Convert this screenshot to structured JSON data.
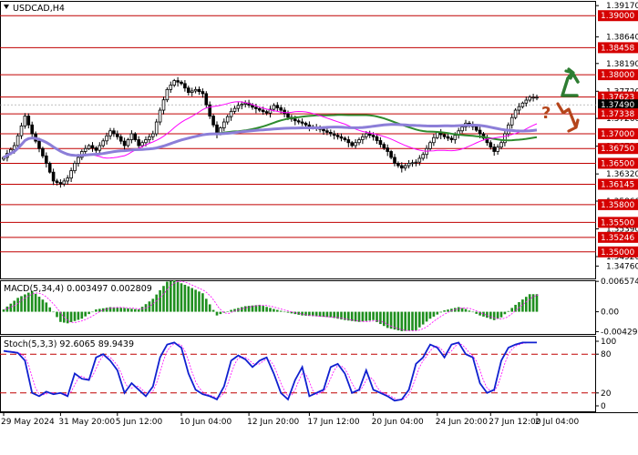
{
  "chart_data": [
    {
      "type": "candlestick",
      "title": "USDCAD,H4",
      "ylim": [
        1.3455,
        1.3925
      ],
      "y_ticks": [
        "1.39170",
        "1.38640",
        "1.38190",
        "1.37720",
        "1.37260",
        "1.36790",
        "1.36320",
        "1.35860",
        "1.35390",
        "1.34920",
        "1.34760"
      ],
      "levels": [
        {
          "value": 1.39,
          "label": "1.39000",
          "kind": "level"
        },
        {
          "value": 1.38458,
          "label": "1.38458",
          "kind": "level"
        },
        {
          "value": 1.38,
          "label": "1.38000",
          "kind": "level"
        },
        {
          "value": 1.37623,
          "label": "1.37623",
          "kind": "level"
        },
        {
          "value": 1.3749,
          "label": "1.37490",
          "kind": "price"
        },
        {
          "value": 1.37338,
          "label": "1.37338",
          "kind": "level"
        },
        {
          "value": 1.37,
          "label": "1.37000",
          "kind": "level"
        },
        {
          "value": 1.3675,
          "label": "1.36750",
          "kind": "level"
        },
        {
          "value": 1.365,
          "label": "1.36500",
          "kind": "level"
        },
        {
          "value": 1.36145,
          "label": "1.36145",
          "kind": "level"
        },
        {
          "value": 1.358,
          "label": "1.35800",
          "kind": "level"
        },
        {
          "value": 1.355,
          "label": "1.35500",
          "kind": "level"
        },
        {
          "value": 1.35246,
          "label": "1.35246",
          "kind": "level"
        },
        {
          "value": 1.35,
          "label": "1.35000",
          "kind": "level"
        }
      ],
      "anchors": [
        [
          0,
          1.366
        ],
        [
          3,
          1.368
        ],
        [
          6,
          1.373
        ],
        [
          8,
          1.37
        ],
        [
          10,
          1.3675
        ],
        [
          12,
          1.365
        ],
        [
          14,
          1.362
        ],
        [
          16,
          1.3615
        ],
        [
          18,
          1.3625
        ],
        [
          20,
          1.365
        ],
        [
          22,
          1.367
        ],
        [
          24,
          1.368
        ],
        [
          26,
          1.3672
        ],
        [
          28,
          1.3688
        ],
        [
          30,
          1.3705
        ],
        [
          32,
          1.3695
        ],
        [
          34,
          1.368
        ],
        [
          36,
          1.37
        ],
        [
          38,
          1.368
        ],
        [
          40,
          1.369
        ],
        [
          42,
          1.37
        ],
        [
          44,
          1.374
        ],
        [
          46,
          1.3775
        ],
        [
          48,
          1.379
        ],
        [
          50,
          1.3785
        ],
        [
          52,
          1.377
        ],
        [
          54,
          1.3775
        ],
        [
          56,
          1.3768
        ],
        [
          58,
          1.373
        ],
        [
          60,
          1.37
        ],
        [
          62,
          1.372
        ],
        [
          64,
          1.3738
        ],
        [
          66,
          1.3748
        ],
        [
          68,
          1.3752
        ],
        [
          70,
          1.3745
        ],
        [
          72,
          1.374
        ],
        [
          74,
          1.3735
        ],
        [
          76,
          1.3748
        ],
        [
          78,
          1.374
        ],
        [
          80,
          1.3728
        ],
        [
          82,
          1.3722
        ],
        [
          84,
          1.3718
        ],
        [
          86,
          1.3712
        ],
        [
          88,
          1.371
        ],
        [
          90,
          1.3705
        ],
        [
          92,
          1.37
        ],
        [
          94,
          1.3695
        ],
        [
          96,
          1.369
        ],
        [
          98,
          1.368
        ],
        [
          100,
          1.369
        ],
        [
          102,
          1.37
        ],
        [
          104,
          1.3695
        ],
        [
          106,
          1.3682
        ],
        [
          108,
          1.367
        ],
        [
          110,
          1.365
        ],
        [
          112,
          1.3642
        ],
        [
          114,
          1.365
        ],
        [
          116,
          1.3652
        ],
        [
          118,
          1.3665
        ],
        [
          120,
          1.3685
        ],
        [
          122,
          1.3702
        ],
        [
          124,
          1.3695
        ],
        [
          126,
          1.369
        ],
        [
          128,
          1.3705
        ],
        [
          130,
          1.3718
        ],
        [
          132,
          1.3712
        ],
        [
          134,
          1.37
        ],
        [
          136,
          1.3685
        ],
        [
          138,
          1.367
        ],
        [
          140,
          1.3685
        ],
        [
          142,
          1.3715
        ],
        [
          144,
          1.374
        ],
        [
          146,
          1.3752
        ],
        [
          148,
          1.3762
        ]
      ],
      "moving_averages": [
        {
          "color": "#2e8b2e",
          "period": 60
        },
        {
          "color": "#ff00ff",
          "period": 22
        },
        {
          "color": "#8c7ed8",
          "period": 90
        }
      ],
      "x_ticks": [
        {
          "index": 0,
          "label": "29 May 2024"
        },
        {
          "index": 16,
          "label": "31 May 20:00"
        },
        {
          "index": 32,
          "label": "5 Jun 12:00"
        },
        {
          "index": 50,
          "label": "10 Jun 04:00"
        },
        {
          "index": 69,
          "label": "12 Jun 20:00"
        },
        {
          "index": 86,
          "label": "17 Jun 12:00"
        },
        {
          "index": 104,
          "label": "20 Jun 04:00"
        },
        {
          "index": 122,
          "label": "24 Jun 20:00"
        },
        {
          "index": 137,
          "label": "27 Jun 12:00"
        },
        {
          "index": 150,
          "label": "2 Jul 04:00"
        }
      ],
      "annotations": {
        "question_mark": "?",
        "up_arrow_color": "#2e7d32",
        "down_arrow_color": "#b5451b"
      }
    },
    {
      "type": "bar",
      "title": "MACD(5,34,4) 0.003497 0.002809",
      "ylim": [
        -0.0048,
        0.0068
      ],
      "y_ticks": [
        "0.006574",
        "0.00",
        "-0.004292"
      ],
      "bar_color": "#1f8f1f",
      "signal_color": "#ff00ff",
      "anchors": [
        [
          0,
          0.0005
        ],
        [
          4,
          0.003
        ],
        [
          8,
          0.0045
        ],
        [
          12,
          0.002
        ],
        [
          16,
          -0.0022
        ],
        [
          18,
          -0.0025
        ],
        [
          22,
          -0.0015
        ],
        [
          26,
          0.0005
        ],
        [
          30,
          0.001
        ],
        [
          34,
          0.0008
        ],
        [
          38,
          0.0005
        ],
        [
          42,
          0.0028
        ],
        [
          46,
          0.0065
        ],
        [
          48,
          0.0068
        ],
        [
          52,
          0.0055
        ],
        [
          56,
          0.004
        ],
        [
          60,
          -0.0008
        ],
        [
          64,
          0.0004
        ],
        [
          68,
          0.0012
        ],
        [
          72,
          0.0015
        ],
        [
          76,
          0.0006
        ],
        [
          80,
          -0.0002
        ],
        [
          84,
          -0.0008
        ],
        [
          88,
          -0.001
        ],
        [
          92,
          -0.0012
        ],
        [
          96,
          -0.0018
        ],
        [
          100,
          -0.0022
        ],
        [
          104,
          -0.0018
        ],
        [
          108,
          -0.0035
        ],
        [
          112,
          -0.0042
        ],
        [
          116,
          -0.004
        ],
        [
          120,
          -0.0015
        ],
        [
          124,
          0.0003
        ],
        [
          128,
          0.001
        ],
        [
          130,
          0.0006
        ],
        [
          134,
          -0.0008
        ],
        [
          138,
          -0.0018
        ],
        [
          140,
          -0.0012
        ],
        [
          144,
          0.0015
        ],
        [
          148,
          0.0038
        ]
      ]
    },
    {
      "type": "line",
      "title": "Stoch(5,3,3) 92.6065 89.9439",
      "ylim": [
        0,
        100
      ],
      "y_ticks": [
        "100",
        "80",
        "20",
        "0"
      ],
      "levels": [
        80,
        20
      ],
      "main_color": "#1020d0",
      "signal_color": "#ff00ff",
      "anchors": [
        [
          0,
          85
        ],
        [
          4,
          82
        ],
        [
          6,
          70
        ],
        [
          8,
          20
        ],
        [
          10,
          15
        ],
        [
          12,
          22
        ],
        [
          14,
          18
        ],
        [
          16,
          20
        ],
        [
          18,
          15
        ],
        [
          20,
          50
        ],
        [
          22,
          42
        ],
        [
          24,
          40
        ],
        [
          26,
          75
        ],
        [
          28,
          80
        ],
        [
          30,
          70
        ],
        [
          32,
          55
        ],
        [
          34,
          20
        ],
        [
          36,
          35
        ],
        [
          38,
          25
        ],
        [
          40,
          15
        ],
        [
          42,
          30
        ],
        [
          44,
          75
        ],
        [
          46,
          95
        ],
        [
          48,
          98
        ],
        [
          50,
          90
        ],
        [
          52,
          50
        ],
        [
          54,
          25
        ],
        [
          56,
          18
        ],
        [
          58,
          15
        ],
        [
          60,
          10
        ],
        [
          62,
          30
        ],
        [
          64,
          70
        ],
        [
          66,
          78
        ],
        [
          68,
          72
        ],
        [
          70,
          60
        ],
        [
          72,
          70
        ],
        [
          74,
          75
        ],
        [
          76,
          50
        ],
        [
          78,
          20
        ],
        [
          80,
          10
        ],
        [
          82,
          40
        ],
        [
          84,
          60
        ],
        [
          86,
          15
        ],
        [
          88,
          20
        ],
        [
          90,
          25
        ],
        [
          92,
          60
        ],
        [
          94,
          65
        ],
        [
          96,
          50
        ],
        [
          98,
          20
        ],
        [
          100,
          25
        ],
        [
          102,
          55
        ],
        [
          104,
          25
        ],
        [
          106,
          20
        ],
        [
          108,
          15
        ],
        [
          110,
          8
        ],
        [
          112,
          10
        ],
        [
          114,
          25
        ],
        [
          116,
          65
        ],
        [
          118,
          75
        ],
        [
          120,
          95
        ],
        [
          122,
          90
        ],
        [
          124,
          75
        ],
        [
          126,
          95
        ],
        [
          128,
          98
        ],
        [
          130,
          80
        ],
        [
          132,
          75
        ],
        [
          134,
          35
        ],
        [
          136,
          20
        ],
        [
          138,
          25
        ],
        [
          140,
          70
        ],
        [
          142,
          90
        ],
        [
          144,
          95
        ],
        [
          146,
          98
        ]
      ]
    }
  ]
}
